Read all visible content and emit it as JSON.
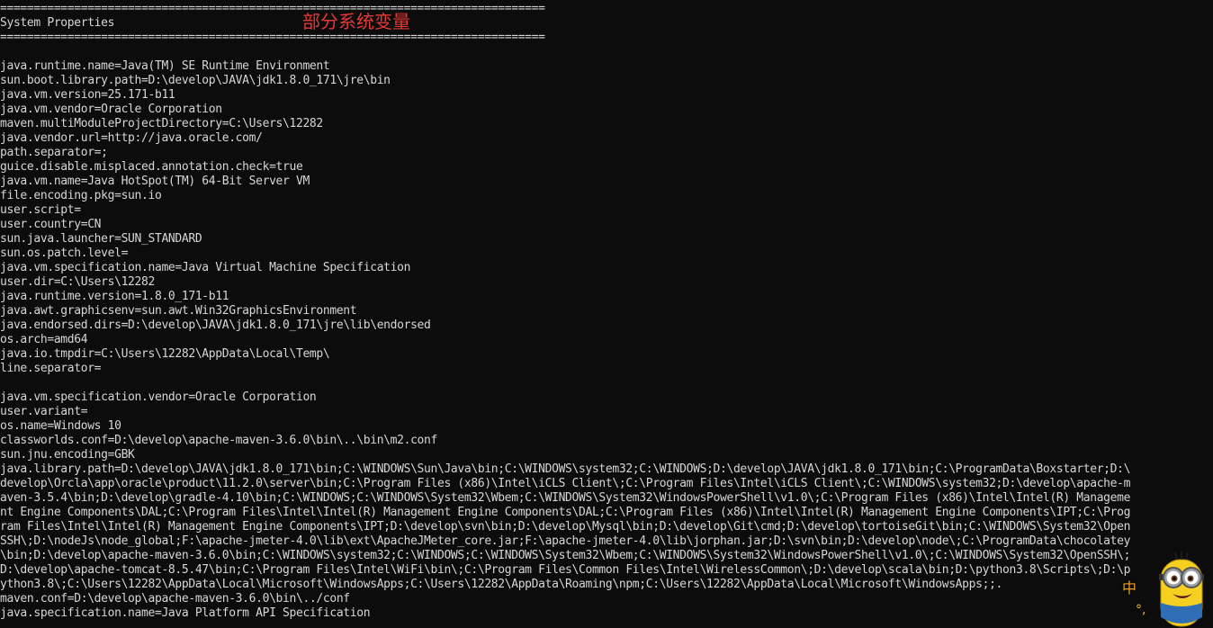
{
  "console": {
    "lines": [
      "=================================================================================",
      "System Properties",
      "=================================================================================",
      "",
      "java.runtime.name=Java(TM) SE Runtime Environment",
      "sun.boot.library.path=D:\\develop\\JAVA\\jdk1.8.0_171\\jre\\bin",
      "java.vm.version=25.171-b11",
      "java.vm.vendor=Oracle Corporation",
      "maven.multiModuleProjectDirectory=C:\\Users\\12282",
      "java.vendor.url=http://java.oracle.com/",
      "path.separator=;",
      "guice.disable.misplaced.annotation.check=true",
      "java.vm.name=Java HotSpot(TM) 64-Bit Server VM",
      "file.encoding.pkg=sun.io",
      "user.script=",
      "user.country=CN",
      "sun.java.launcher=SUN_STANDARD",
      "sun.os.patch.level=",
      "java.vm.specification.name=Java Virtual Machine Specification",
      "user.dir=C:\\Users\\12282",
      "java.runtime.version=1.8.0_171-b11",
      "java.awt.graphicsenv=sun.awt.Win32GraphicsEnvironment",
      "java.endorsed.dirs=D:\\develop\\JAVA\\jdk1.8.0_171\\jre\\lib\\endorsed",
      "os.arch=amd64",
      "java.io.tmpdir=C:\\Users\\12282\\AppData\\Local\\Temp\\",
      "line.separator=",
      "",
      "java.vm.specification.vendor=Oracle Corporation",
      "user.variant=",
      "os.name=Windows 10",
      "classworlds.conf=D:\\develop\\apache-maven-3.6.0\\bin\\..\\bin\\m2.conf",
      "sun.jnu.encoding=GBK",
      "java.library.path=D:\\develop\\JAVA\\jdk1.8.0_171\\bin;C:\\WINDOWS\\Sun\\Java\\bin;C:\\WINDOWS\\system32;C:\\WINDOWS;D:\\develop\\JAVA\\jdk1.8.0_171\\bin;C:\\ProgramData\\Boxstarter;D:\\",
      "develop\\Orcla\\app\\oracle\\product\\11.2.0\\server\\bin;C:\\Program Files (x86)\\Intel\\iCLS Client\\;C:\\Program Files\\Intel\\iCLS Client\\;C:\\WINDOWS\\system32;D:\\develop\\apache-m",
      "aven-3.5.4\\bin;D:\\develop\\gradle-4.10\\bin;C:\\WINDOWS;C:\\WINDOWS\\System32\\Wbem;C:\\WINDOWS\\System32\\WindowsPowerShell\\v1.0\\;C:\\Program Files (x86)\\Intel\\Intel(R) Manageme",
      "nt Engine Components\\DAL;C:\\Program Files\\Intel\\Intel(R) Management Engine Components\\DAL;C:\\Program Files (x86)\\Intel\\Intel(R) Management Engine Components\\IPT;C:\\Prog",
      "ram Files\\Intel\\Intel(R) Management Engine Components\\IPT;D:\\develop\\svn\\bin;D:\\develop\\Mysql\\bin;D:\\develop\\Git\\cmd;D:\\develop\\tortoiseGit\\bin;C:\\WINDOWS\\System32\\Open",
      "SSH\\;D:\\nodeJs\\node_global;F:\\apache-jmeter-4.0\\lib\\ext\\ApacheJMeter_core.jar;F:\\apache-jmeter-4.0\\lib\\jorphan.jar;D:\\svn\\bin;D:\\develop\\node\\;C:\\ProgramData\\chocolatey",
      "\\bin;D:\\develop\\apache-maven-3.6.0\\bin;C:\\WINDOWS\\system32;C:\\WINDOWS;C:\\WINDOWS\\System32\\Wbem;C:\\WINDOWS\\System32\\WindowsPowerShell\\v1.0\\;C:\\WINDOWS\\System32\\OpenSSH\\;",
      "D:\\develop\\apache-tomcat-8.5.47\\bin;C:\\Program Files\\Intel\\WiFi\\bin\\;C:\\Program Files\\Common Files\\Intel\\WirelessCommon\\;D:\\develop\\scala\\bin;D:\\python3.8\\Scripts\\;D:\\p",
      "ython3.8\\;C:\\Users\\12282\\AppData\\Local\\Microsoft\\WindowsApps;C:\\Users\\12282\\AppData\\Roaming\\npm;C:\\Users\\12282\\AppData\\Local\\Microsoft\\WindowsApps;;.",
      "maven.conf=D:\\develop\\apache-maven-3.6.0\\bin\\../conf",
      "java.specification.name=Java Platform API Specification"
    ]
  },
  "annotation": {
    "text": "部分系统变量",
    "color": "#e53935"
  },
  "overlay": {
    "ime_glyph": "中",
    "ime_mark": "°,",
    "mascot_icon": "minion-mascot-icon"
  },
  "colors": {
    "background": "#0c0c0c",
    "text": "#d6d6d6"
  }
}
